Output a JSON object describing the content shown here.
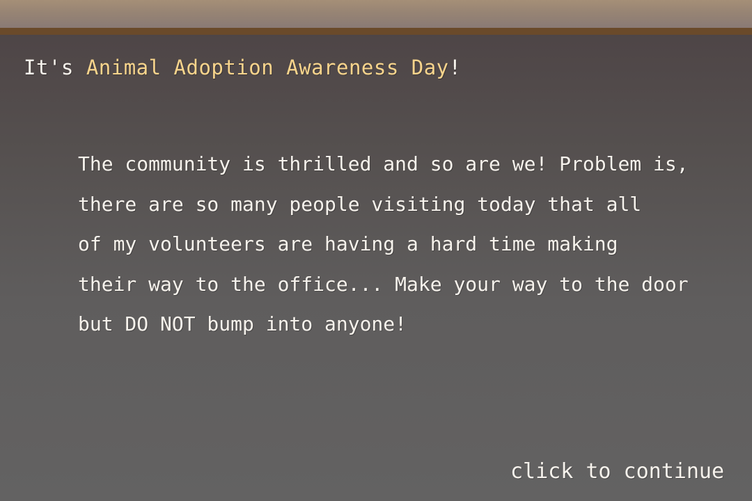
{
  "headline": {
    "prefix": "It's ",
    "highlight": "Animal Adoption Awareness Day",
    "suffix": "!"
  },
  "message": {
    "lines": [
      "The community is thrilled and so are we! Problem is,",
      "there are so many people visiting today that all",
      "of my volunteers are having a hard time making",
      "their way to the office... Make your way to the door",
      "but DO NOT bump into anyone!"
    ]
  },
  "continue_prompt": "click to continue",
  "colors": {
    "text": "#f6f2ec",
    "highlight": "#f7d48c",
    "header_band": "#978474",
    "header_stripe": "#6a4a2a",
    "background": "#5a5556"
  }
}
